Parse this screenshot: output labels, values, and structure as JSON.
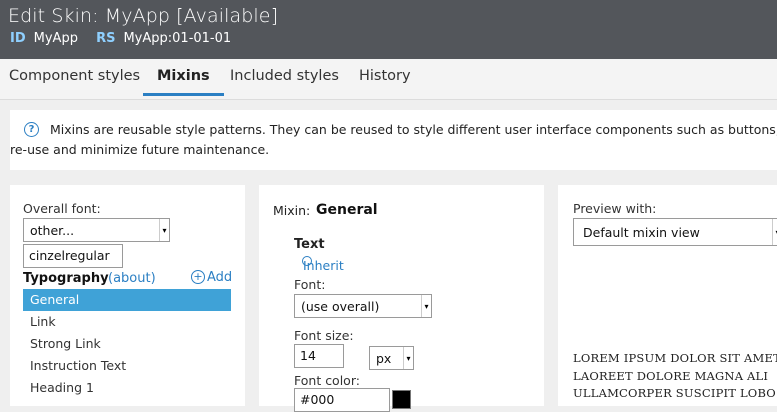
{
  "header": {
    "title": "Edit Skin: MyApp [Available]",
    "id_key": "ID",
    "id_value": "MyApp",
    "rs_key": "RS",
    "rs_value": "MyApp:01-01-01"
  },
  "tabs": [
    {
      "label": "Component styles"
    },
    {
      "label": "Mixins"
    },
    {
      "label": "Included styles"
    },
    {
      "label": "History"
    }
  ],
  "info": {
    "icon": "?",
    "line1": "Mixins are reusable style patterns. They can be reused to style different user interface components such as buttons, links e",
    "line2": "re-use and minimize future maintenance."
  },
  "left": {
    "overall_font_label": "Overall font:",
    "overall_font_value": "other...",
    "font_name_value": "cinzelregular",
    "typography_label": "Typography",
    "about_label": "(about)",
    "add_label": "Add",
    "items": [
      "General",
      "Link",
      "Strong Link",
      "Instruction Text",
      "Heading 1"
    ]
  },
  "mid": {
    "mixin_label": "Mixin:",
    "mixin_value": "General",
    "text_heading": "Text",
    "inherit_label": "Inherit",
    "font_label": "Font:",
    "font_value": "(use overall)",
    "font_size_label": "Font size:",
    "font_size_value": "14",
    "font_unit_value": "px",
    "font_color_label": "Font color:",
    "font_color_value": "#000"
  },
  "right": {
    "preview_label": "Preview with:",
    "preview_value": "Default mixin view",
    "lorem_lines": [
      "LOREM IPSUM DOLOR SIT AMET",
      "LAOREET DOLORE MAGNA ALI",
      "ULLAMCORPER SUSCIPIT LOBO"
    ]
  },
  "colors": {
    "header_bg": "#53565b",
    "accent": "#2b7fc3",
    "selected_item": "#3fa2d7"
  }
}
